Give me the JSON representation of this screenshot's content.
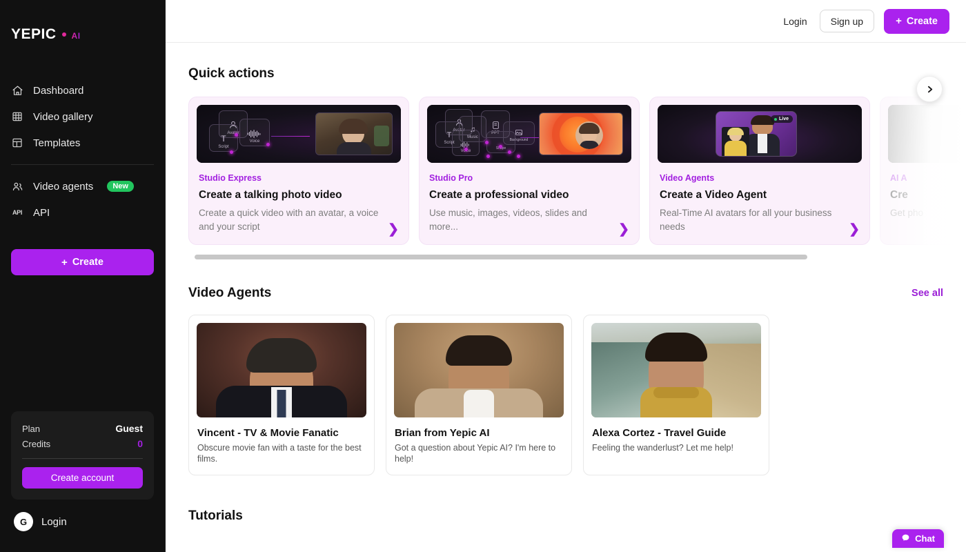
{
  "sidebar": {
    "logo": {
      "main": "YEPIC",
      "dot_icon": "magenta-dot",
      "suffix": "AI"
    },
    "nav": [
      {
        "label": "Dashboard",
        "icon": "home-icon"
      },
      {
        "label": "Video gallery",
        "icon": "film-icon"
      },
      {
        "label": "Templates",
        "icon": "layout-icon"
      },
      {
        "label": "Video agents",
        "icon": "users-icon",
        "badge": "New"
      },
      {
        "label": "API",
        "icon": "api-icon"
      }
    ],
    "create_button": {
      "label": "Create",
      "plus": "+"
    },
    "plan_card": {
      "plan_key": "Plan",
      "plan_value": "Guest",
      "credits_key": "Credits",
      "credits_value": "0",
      "create_account_label": "Create account"
    },
    "footer": {
      "avatar_initial": "G",
      "login_label": "Login"
    }
  },
  "topbar": {
    "login_label": "Login",
    "signup_label": "Sign up",
    "create_label": "Create",
    "create_plus": "+"
  },
  "quick_actions": {
    "title": "Quick actions",
    "next_icon": "chevron-right-icon",
    "cards": [
      {
        "tag": "Studio Express",
        "title": "Create a talking photo video",
        "desc": "Create a quick video with an avatar, a voice and your script",
        "chevron": "❯",
        "thumb_labels": [
          "Avatar",
          "Voice",
          "Script"
        ]
      },
      {
        "tag": "Studio Pro",
        "title": "Create a professional video",
        "desc": "Use music, images, videos, slides and more...",
        "chevron": "❯",
        "thumb_labels": [
          "Avatar",
          "Music",
          "PPT",
          "Background",
          "Shape",
          "Script",
          "Voice"
        ]
      },
      {
        "tag": "Video Agents",
        "title": "Create a Video Agent",
        "desc": "Real-Time AI avatars for all your business needs",
        "chevron": "❯",
        "thumb_labels": [
          "Live"
        ]
      },
      {
        "tag": "AI A",
        "title": "Cre",
        "desc": "Get pho",
        "chevron": "❯",
        "thumb_labels": []
      }
    ]
  },
  "video_agents": {
    "title": "Video Agents",
    "see_all": "See all",
    "cards": [
      {
        "name": "Vincent - TV & Movie Fanatic",
        "desc": "Obscure movie fan with a taste for the best films."
      },
      {
        "name": "Brian from Yepic AI",
        "desc": "Got a question about Yepic AI? I'm here to help!"
      },
      {
        "name": "Alexa Cortez - Travel Guide",
        "desc": "Feeling the wanderlust? Let me help!"
      }
    ]
  },
  "tutorials": {
    "title": "Tutorials"
  },
  "chat_widget": {
    "label": "Chat",
    "icon": "chat-bubble-icon"
  },
  "colors": {
    "accent_purple": "#aa22ee",
    "link_purple": "#9b1fd6",
    "brand_magenta": "#e0299b",
    "badge_green": "#22c55e",
    "card_pink": "#fbf0fb",
    "sidebar_bg": "#111111"
  }
}
